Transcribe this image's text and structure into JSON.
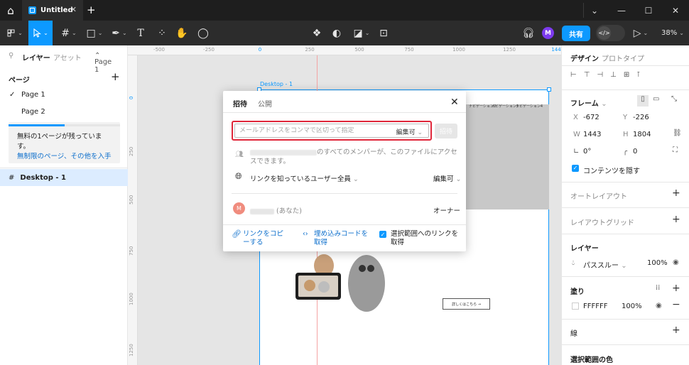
{
  "titlebar": {
    "tab_title": "Untitled",
    "tab_close": "✕",
    "add_tab": "+"
  },
  "window_controls": {
    "minimize": "⌄",
    "min2": "—",
    "maximize": "☐",
    "close": "✕"
  },
  "toolbar": {
    "share_label": "共有",
    "avatar_initial": "M",
    "zoom": "38%",
    "dev_mode": "</>"
  },
  "left_panel": {
    "tabs": [
      "レイヤー",
      "アセット"
    ],
    "page_dropdown": "Page 1",
    "pages_header": "ページ",
    "pages": [
      "Page 1",
      "Page 2"
    ],
    "notice_text": "無料の1ページが残っています。",
    "notice_link": "無制限のページ、その他を入手",
    "notice_progress": 0.5,
    "layer_name": "Desktop - 1"
  },
  "canvas": {
    "frame_label": "Desktop - 1",
    "ruler_top": [
      "-500",
      "-250",
      "0",
      "250",
      "500",
      "750",
      "1000",
      "1250",
      "144"
    ],
    "ruler_left": [
      "0",
      "250",
      "500",
      "750",
      "1000",
      "1250"
    ],
    "nav_items": [
      "ナビゲーション2",
      "ナビゲーション3",
      "ナビゲーション4"
    ],
    "cta_text": "詳しくはこちら →"
  },
  "right_panel": {
    "tabs": [
      "デザイン",
      "プロトタイプ"
    ],
    "frame_label": "フレーム",
    "x_label": "X",
    "x_value": "-672",
    "y_label": "Y",
    "y_value": "-226",
    "w_label": "W",
    "w_value": "1443",
    "h_label": "H",
    "h_value": "1804",
    "rotation": "0°",
    "radius": "0",
    "clip_content": "コンテンツを隠す",
    "auto_layout": "オートレイアウト",
    "layout_grid": "レイアウトグリッド",
    "layer_header": "レイヤー",
    "blend_mode": "パススルー",
    "layer_opacity": "100%",
    "fill_header": "塗り",
    "fill_hex": "FFFFFF",
    "fill_opacity": "100%",
    "stroke_header": "線",
    "selection_colors": "選択範囲の色"
  },
  "modal": {
    "tabs": [
      "招待",
      "公開"
    ],
    "email_placeholder": "メールアドレスをコンマで区切って指定",
    "permission": "編集可",
    "invite_button": "招待",
    "team_access_text": "のすべてのメンバーが、このファイルにアクセスできます。",
    "link_access": "リンクを知っているユーザー全員",
    "link_permission": "編集可",
    "member_avatar": "M",
    "member_suffix": "(あなた)",
    "member_role": "オーナー",
    "copy_link": "リンクをコピーする",
    "embed_code": "埋め込みコードを取得",
    "selection_link": "選択範囲へのリンクを取得"
  },
  "colors": {
    "accent": "#0d99ff",
    "highlight_border": "#e0273a",
    "avatar_purple": "#7c3aed",
    "avatar_salmon": "#f08c7e"
  }
}
